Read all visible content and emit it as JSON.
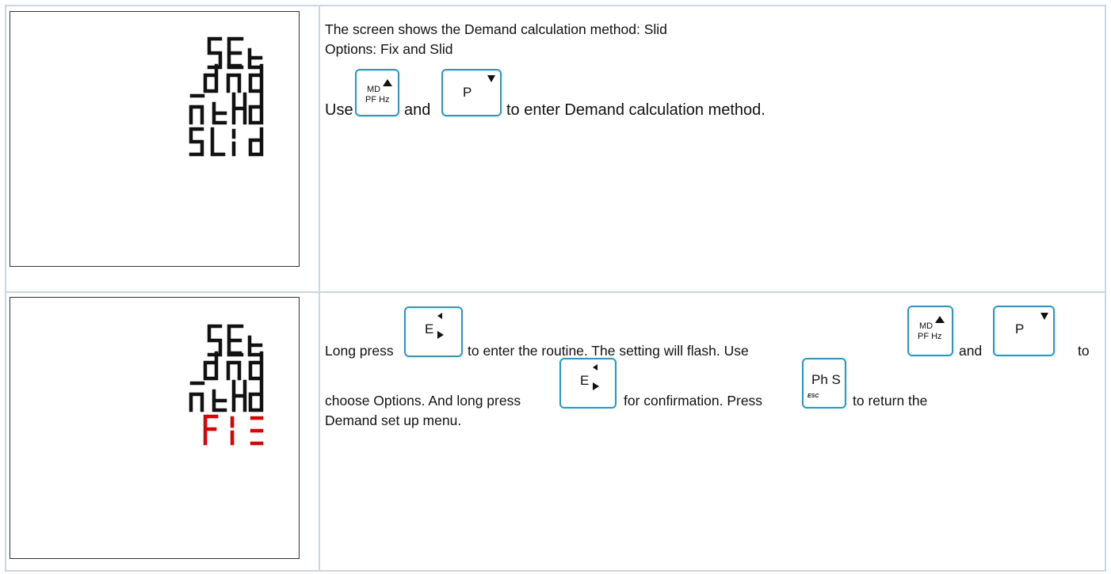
{
  "step1": {
    "lcd_lines": [
      "SEt",
      "dnd",
      "nEHd",
      "SLId"
    ],
    "heading": "The screen shows the Demand calculation method: Slid",
    "options": "Options: Fix and Slid",
    "use_word": "Use",
    "and_word": "and",
    "instruction_tail": "to enter Demand calculation method."
  },
  "step2": {
    "lcd_lines": [
      "SEt",
      "dnd",
      "nEHd",
      "FIE"
    ],
    "highlight_color": "#e00000",
    "long_press": "Long press",
    "enter_routine": "to enter the  routine. The setting will flash. Use",
    "and_word": "and",
    "to_word": "to",
    "choose_options": "choose Options.  And long press",
    "for_confirmation": "for confirmation. Press",
    "to_return": "to return the",
    "menu_text": "Demand set up menu."
  },
  "keys": {
    "md_top": "MD",
    "md_bottom": "PF Hz",
    "p_label": "P",
    "e_label": "E",
    "ph_label": "Ph S",
    "esc_label": "ESC"
  },
  "colors": {
    "key_border": "#1e9ad6",
    "grid": "#c9d6e6"
  }
}
